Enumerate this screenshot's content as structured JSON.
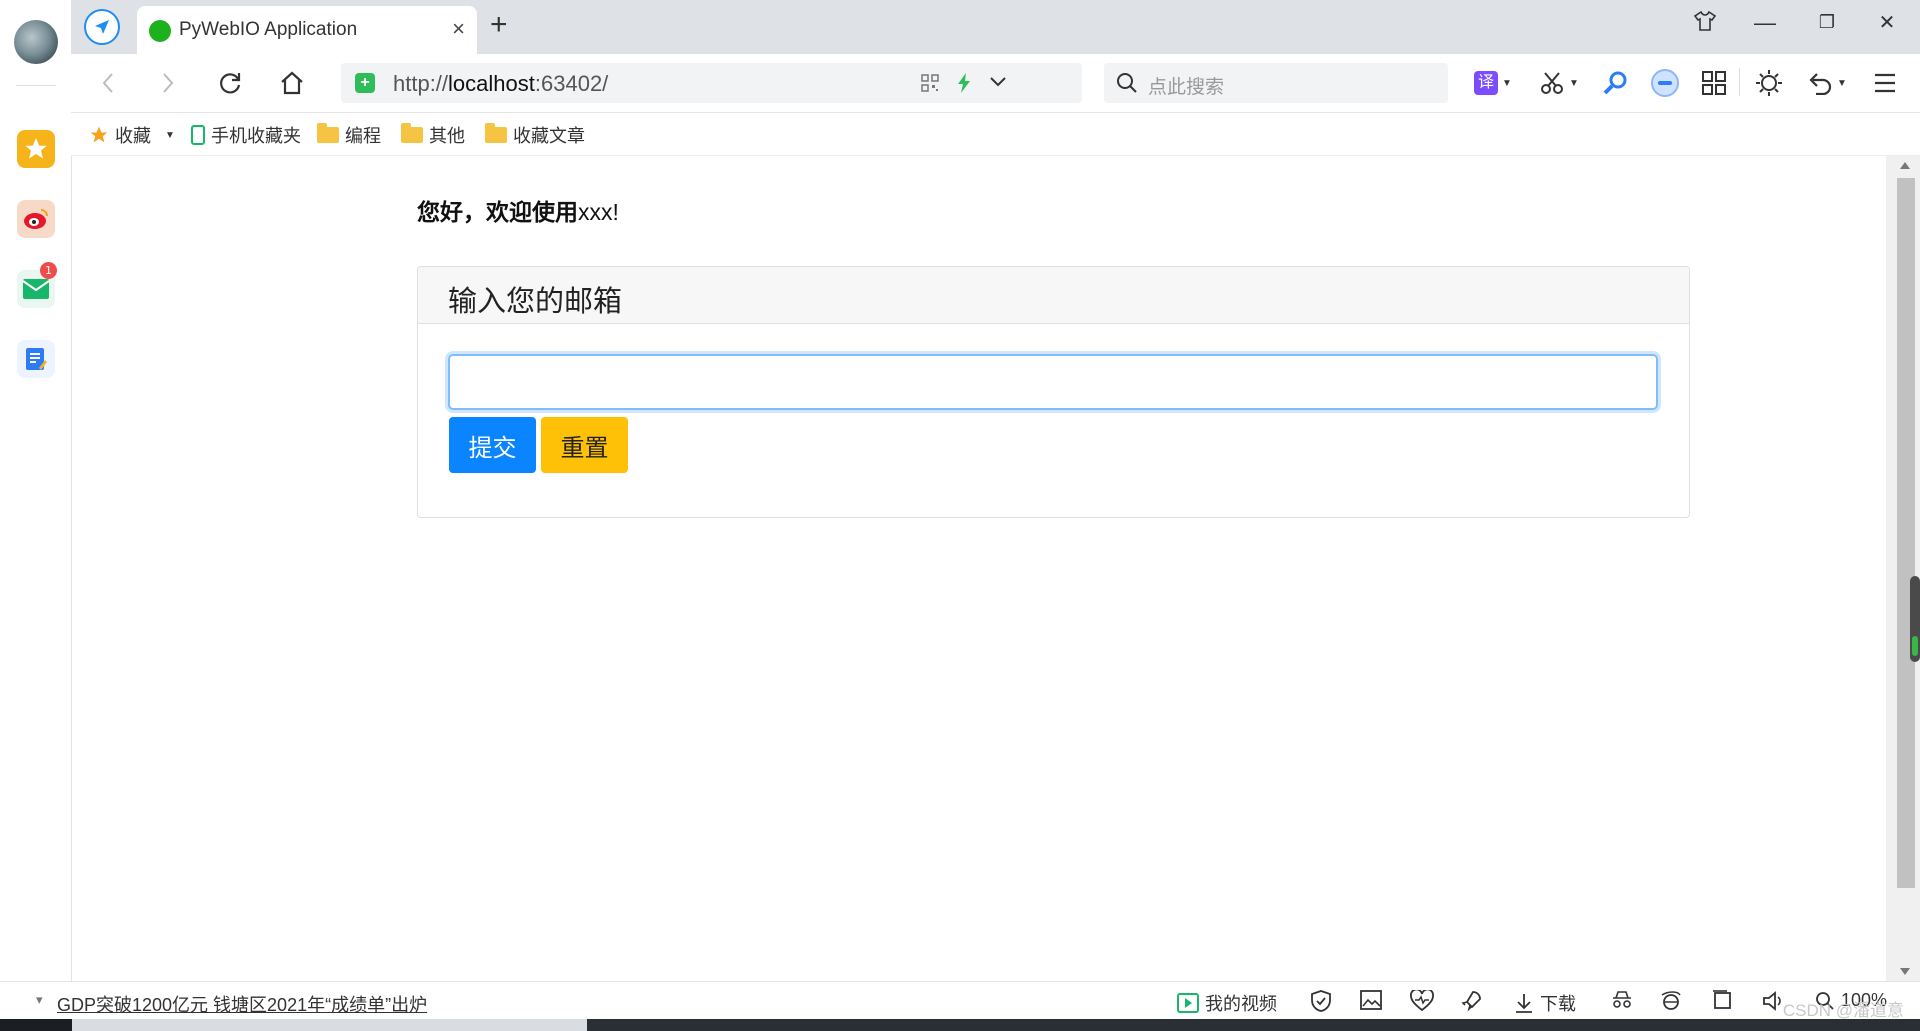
{
  "browser": {
    "tab_title": "PyWebIO Application",
    "tab_close": "×",
    "new_tab": "+",
    "url_scheme": "http://",
    "url_host": "localhost",
    "url_rest": ":63402/",
    "search_placeholder": "点此搜索",
    "translate_label": "译",
    "accent_color": "#1f8ef1",
    "favicon_color": "#1db21d"
  },
  "window_controls": {
    "minimize": "—",
    "maximize": "❐",
    "close": "✕"
  },
  "bookmarks": [
    {
      "label": "收藏",
      "icon": "star-icon"
    },
    {
      "label": "手机收藏夹",
      "icon": "phone-icon"
    },
    {
      "label": "编程",
      "icon": "folder-icon"
    },
    {
      "label": "其他",
      "icon": "folder-icon"
    },
    {
      "label": "收藏文章",
      "icon": "folder-icon"
    }
  ],
  "sidebar": {
    "mail_badge": "1",
    "icons": [
      "favorites-icon",
      "weibo-icon",
      "mail-icon",
      "notes-icon"
    ]
  },
  "page": {
    "welcome_bold": "您好，欢迎使用",
    "welcome_rest": "xxx!",
    "card_title": "输入您的邮箱",
    "email_value": "",
    "submit_label": "提交",
    "reset_label": "重置",
    "submit_color": "#0a84ff",
    "reset_color": "#ffc107"
  },
  "statusbar": {
    "news_text": "GDP突破1200亿元 钱塘区2021年“成绩单”出炉",
    "my_video": "我的视频",
    "download": "下载",
    "zoom": "100%",
    "watermark": "CSDN @潘道意"
  }
}
